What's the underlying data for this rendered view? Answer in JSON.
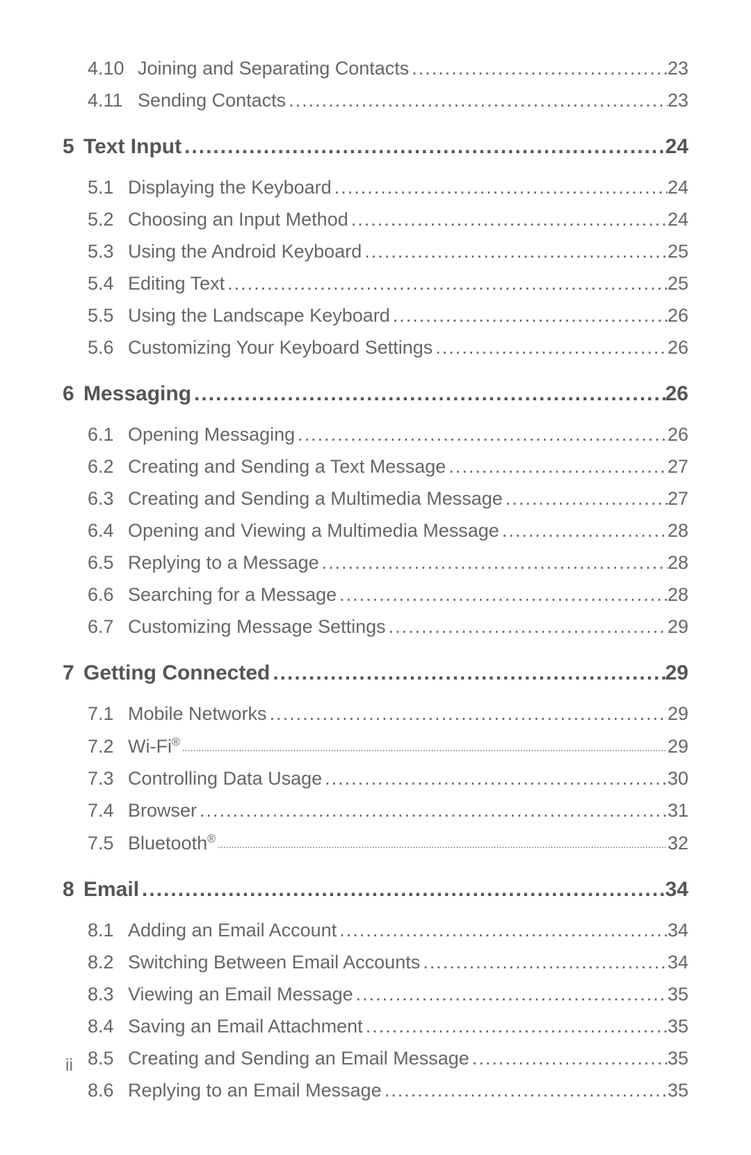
{
  "orphan_subs": [
    {
      "num": "4.10",
      "title": "Joining and Separating Contacts",
      "page": "23",
      "wide": true
    },
    {
      "num": "4.11",
      "title": "Sending Contacts",
      "page": "23",
      "wide": true
    }
  ],
  "chapters": [
    {
      "num": "5",
      "title": "Text Input",
      "page": "24",
      "subs": [
        {
          "num": "5.1",
          "title": "Displaying the Keyboard",
          "page": "24"
        },
        {
          "num": "5.2",
          "title": "Choosing an Input Method",
          "page": "24"
        },
        {
          "num": "5.3",
          "title": "Using the Android Keyboard",
          "page": "25"
        },
        {
          "num": "5.4",
          "title": "Editing Text",
          "page": "25"
        },
        {
          "num": "5.5",
          "title": "Using the Landscape Keyboard",
          "page": "26"
        },
        {
          "num": "5.6",
          "title": "Customizing Your Keyboard Settings",
          "page": "26"
        }
      ]
    },
    {
      "num": "6",
      "title": "Messaging",
      "page": "26",
      "subs": [
        {
          "num": "6.1",
          "title": "Opening Messaging",
          "page": "26"
        },
        {
          "num": "6.2",
          "title": "Creating and Sending a Text Message",
          "page": "27"
        },
        {
          "num": "6.3",
          "title": "Creating and Sending a Multimedia Message",
          "page": "27"
        },
        {
          "num": "6.4",
          "title": "Opening and Viewing a Multimedia Message",
          "page": "28"
        },
        {
          "num": "6.5",
          "title": "Replying to a Message",
          "page": "28"
        },
        {
          "num": "6.6",
          "title": "Searching for a Message",
          "page": "28"
        },
        {
          "num": "6.7",
          "title": "Customizing Message Settings",
          "page": "29"
        }
      ]
    },
    {
      "num": "7",
      "title": "Getting Connected",
      "page": "29",
      "subs": [
        {
          "num": "7.1",
          "title": "Mobile Networks",
          "page": "29"
        },
        {
          "num": "7.2",
          "title": "Wi-Fi",
          "sup": "®",
          "page": "29",
          "smalldots": true
        },
        {
          "num": "7.3",
          "title": "Controlling Data Usage",
          "page": "30"
        },
        {
          "num": "7.4",
          "title": "Browser",
          "page": "31"
        },
        {
          "num": "7.5",
          "title": "Bluetooth",
          "sup": "®",
          "page": "32",
          "smalldots": true
        }
      ]
    },
    {
      "num": "8",
      "title": "Email",
      "page": "34",
      "subs": [
        {
          "num": "8.1",
          "title": "Adding an Email Account",
          "page": "34"
        },
        {
          "num": "8.2",
          "title": "Switching Between Email Accounts",
          "page": "34"
        },
        {
          "num": "8.3",
          "title": "Viewing an Email Message",
          "page": "35"
        },
        {
          "num": "8.4",
          "title": "Saving an Email Attachment",
          "page": "35"
        },
        {
          "num": "8.5",
          "title": "Creating and Sending an Email Message",
          "page": "35"
        },
        {
          "num": "8.6",
          "title": "Replying to an Email Message",
          "page": "35"
        }
      ]
    }
  ],
  "footer_page": "ii"
}
